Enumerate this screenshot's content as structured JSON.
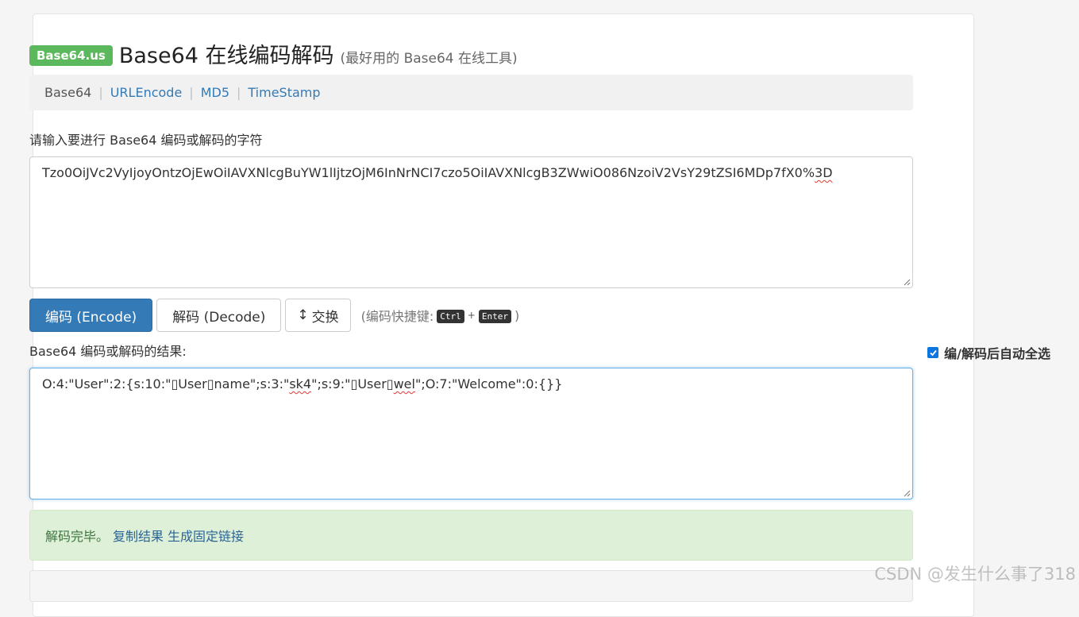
{
  "header": {
    "brand": "Base64.us",
    "title": "Base64 在线编码解码",
    "subtitle": "(最好用的 Base64 在线工具)"
  },
  "nav": {
    "active": "Base64",
    "links": [
      "URLEncode",
      "MD5",
      "TimeStamp"
    ],
    "separator": "|"
  },
  "input": {
    "label": "请输入要进行 Base64 编码或解码的字符",
    "value_main": "Tzo0OiJVc2VyIjoyOntzOjEwOiIAVXNlcgBuYW1lIjtzOjM6InNrNCI7czo5OiIAVXNlcgB3ZWwiO086NzoiV2VsY29tZSI6MDp7fX0%",
    "value_tail": "3D"
  },
  "buttons": {
    "encode": "编码 (Encode)",
    "decode": "解码 (Decode)",
    "swap_icon": "↕",
    "swap": "交换"
  },
  "shortcut": {
    "prefix": "(编码快捷键:",
    "key1": "Ctrl",
    "plus": "+",
    "key2": "Enter",
    "suffix": ")"
  },
  "output": {
    "label": "Base64 编码或解码的结果:",
    "autoselect_label": "编/解码后自动全选",
    "autoselect_checked": true,
    "segments": [
      "O:4:\"User\":2:{s:10:\"▯",
      "User",
      "▯",
      "name\";s:3:\"",
      "sk4",
      "\";s:9:\"▯",
      "User",
      "▯",
      "wel",
      "\";O:7:\"Welcome\":0:{}}"
    ]
  },
  "alert": {
    "message": "解码完毕。",
    "copy_link": "复制结果",
    "permalink": "生成固定链接"
  },
  "watermark": "CSDN @发生什么事了318",
  "colors": {
    "brand_green": "#5cb85c",
    "primary_blue": "#337ab7",
    "link_blue": "#337ab7",
    "alert_bg": "#dff0d8",
    "alert_text": "#3c763d",
    "checkbox_blue": "#0b75e0"
  }
}
